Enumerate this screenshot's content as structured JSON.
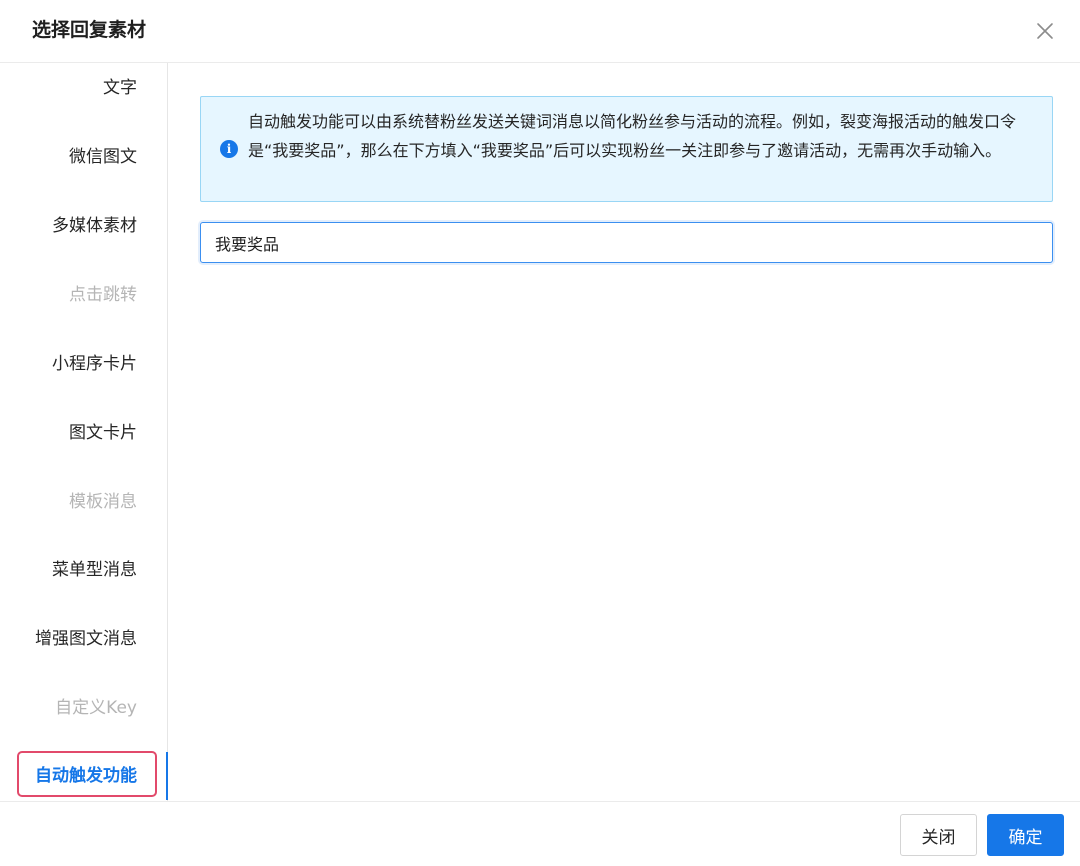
{
  "dialog": {
    "title": "选择回复素材",
    "close_icon": "close-icon"
  },
  "sidebar": {
    "items": [
      {
        "label": "文字",
        "state": "enabled"
      },
      {
        "label": "微信图文",
        "state": "enabled"
      },
      {
        "label": "多媒体素材",
        "state": "enabled"
      },
      {
        "label": "点击跳转",
        "state": "disabled"
      },
      {
        "label": "小程序卡片",
        "state": "enabled"
      },
      {
        "label": "图文卡片",
        "state": "enabled"
      },
      {
        "label": "模板消息",
        "state": "disabled"
      },
      {
        "label": "菜单型消息",
        "state": "enabled"
      },
      {
        "label": "增强图文消息",
        "state": "enabled"
      },
      {
        "label": "自定义Key",
        "state": "disabled"
      },
      {
        "label": "自动触发功能",
        "state": "active"
      }
    ]
  },
  "info": {
    "icon": "info-icon",
    "text": "自动触发功能可以由系统替粉丝发送关键词消息以简化粉丝参与活动的流程。例如，裂变海报活动的触发口令是“我要奖品”，那么在下方填入“我要奖品”后可以实现粉丝一关注即参与了邀请活动，无需再次手动输入。"
  },
  "keyword_input": {
    "value": "我要奖品"
  },
  "footer": {
    "close_label": "关闭",
    "confirm_label": "确定"
  },
  "colors": {
    "accent": "#1677e8",
    "info_bg": "#e6f6ff",
    "info_border": "#99d6f5",
    "highlight": "#e24a6b",
    "disabled_text": "#b5b5b5"
  }
}
